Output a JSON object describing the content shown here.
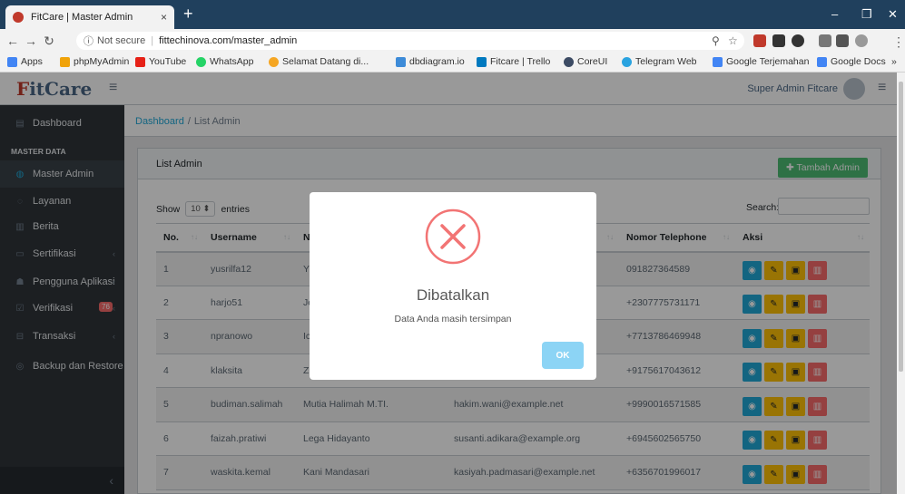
{
  "browser": {
    "tab_title": "FitCare | Master Admin",
    "tab_close": "×",
    "new_tab": "+",
    "minimize": "–",
    "restore": "❐",
    "close": "✕",
    "not_secure": "Not secure",
    "url": "fittechinova.com/master_admin",
    "bookmarks": [
      "Apps",
      "phpMyAdmin",
      "YouTube",
      "WhatsApp",
      "Selamat Datang di...",
      "dbdiagram.io",
      "Fitcare | Trello",
      "CoreUI",
      "Telegram Web",
      "Google Terjemahan",
      "Google Docs"
    ],
    "bookmarks_more": "»"
  },
  "header": {
    "logo_f": "F",
    "logo_rest": "itCare",
    "user": "Super Admin Fitcare"
  },
  "sidebar": {
    "dashboard": "Dashboard",
    "section": "MASTER DATA",
    "items": [
      "Master Admin",
      "Layanan",
      "Berita",
      "Sertifikasi",
      "Pengguna Aplikasi",
      "Verifikasi",
      "Transaksi",
      "Backup dan Restore"
    ],
    "badge": "76"
  },
  "breadcrumb": {
    "home": "Dashboard",
    "sep": "/",
    "current": "List Admin"
  },
  "card": {
    "title": "List Admin",
    "add_button": "Tambah Admin",
    "show": "Show",
    "entries_value": "10",
    "entries": "entries",
    "search": "Search:"
  },
  "table": {
    "headers": [
      "No.",
      "Username",
      "N",
      "Nomor Telephone",
      "Aksi"
    ],
    "rows": [
      {
        "no": "1",
        "username": "yusrilfa12",
        "name": "Y",
        "email": "",
        "phone": "091827364589"
      },
      {
        "no": "2",
        "username": "harjo51",
        "name": "Je",
        "email": "",
        "phone": "+2307775731171"
      },
      {
        "no": "3",
        "username": "npranowo",
        "name": "Ic",
        "email": "",
        "phone": "+7713786469948"
      },
      {
        "no": "4",
        "username": "klaksita",
        "name": "Zi",
        "email": "",
        "phone": "+9175617043612"
      },
      {
        "no": "5",
        "username": "budiman.salimah",
        "name": "Mutia Halimah M.TI.",
        "email": "hakim.wani@example.net",
        "phone": "+9990016571585"
      },
      {
        "no": "6",
        "username": "faizah.pratiwi",
        "name": "Lega Hidayanto",
        "email": "susanti.adikara@example.org",
        "phone": "+6945602565750"
      },
      {
        "no": "7",
        "username": "waskita.kemal",
        "name": "Kani Mandasari",
        "email": "kasiyah.padmasari@example.net",
        "phone": "+6356701996017"
      }
    ]
  },
  "modal": {
    "title": "Dibatalkan",
    "text": "Data Anda masih tersimpan",
    "ok": "OK"
  },
  "colors": {
    "success": "#4dbd74",
    "info": "#20a8d8",
    "warning": "#ffc107",
    "danger": "#f86c6b",
    "error_icon": "#f27474"
  }
}
